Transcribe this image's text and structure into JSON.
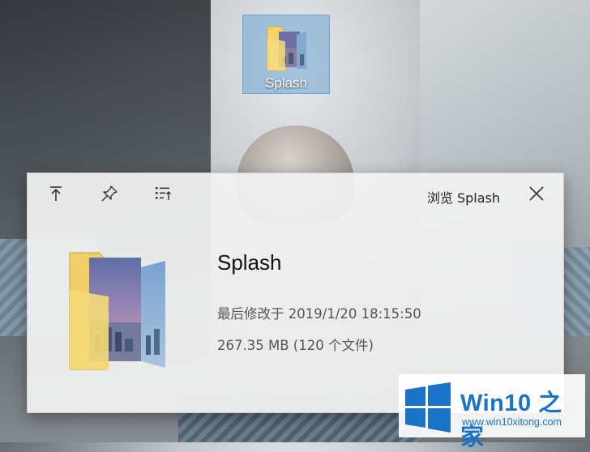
{
  "desktop": {
    "icon_label": "Splash",
    "icon": "folder-with-photo-icon"
  },
  "flyout": {
    "title": "浏览 Splash",
    "toolbar": {
      "buttons": [
        {
          "icon": "move-to-top-icon"
        },
        {
          "icon": "pin-icon"
        },
        {
          "icon": "sort-list-icon"
        }
      ],
      "close_icon": "close-icon"
    },
    "item": {
      "name": "Splash",
      "modified": "最后修改于 2019/1/20 18:15:50",
      "size": "267.35 MB (120 个文件)",
      "icon": "folder-with-photo-icon"
    }
  },
  "watermark": {
    "title_prefix": "Win10",
    "title_suffix": "之家",
    "url": "www.win10xitong.com",
    "logo": "windows-logo-icon",
    "color": "#1a73c7"
  }
}
